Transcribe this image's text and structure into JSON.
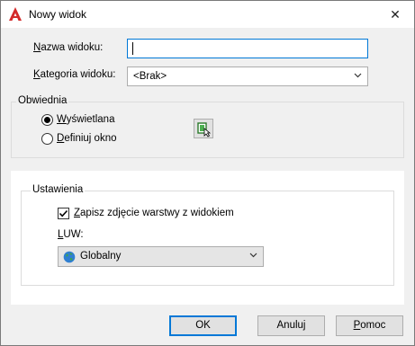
{
  "window": {
    "title": "Nowy widok",
    "close_glyph": "✕"
  },
  "fields": {
    "view_name_label": "Nazwa widoku:",
    "view_name_value": "",
    "view_category_label": "Kategoria widoku:",
    "view_category_value": "<Brak>"
  },
  "boundary": {
    "title": "Obwiednia",
    "radio_display": "Wyświetlana",
    "radio_define": "Definiuj okno",
    "selected": "Wyświetlana",
    "define_window_icon": "define-window-icon"
  },
  "settings": {
    "title": "Ustawienia",
    "save_layer_snapshot": "Zapisz zdjęcie warstwy z widokiem",
    "save_layer_snapshot_checked": true,
    "ucs_label": "LUW:",
    "ucs_value": "Globalny",
    "ucs_icon": "globe-icon"
  },
  "buttons": {
    "ok": "OK",
    "cancel": "Anuluj",
    "help": "Pomoc"
  },
  "colors": {
    "accent": "#0078d7",
    "app_icon_red": "#d32a2a"
  }
}
